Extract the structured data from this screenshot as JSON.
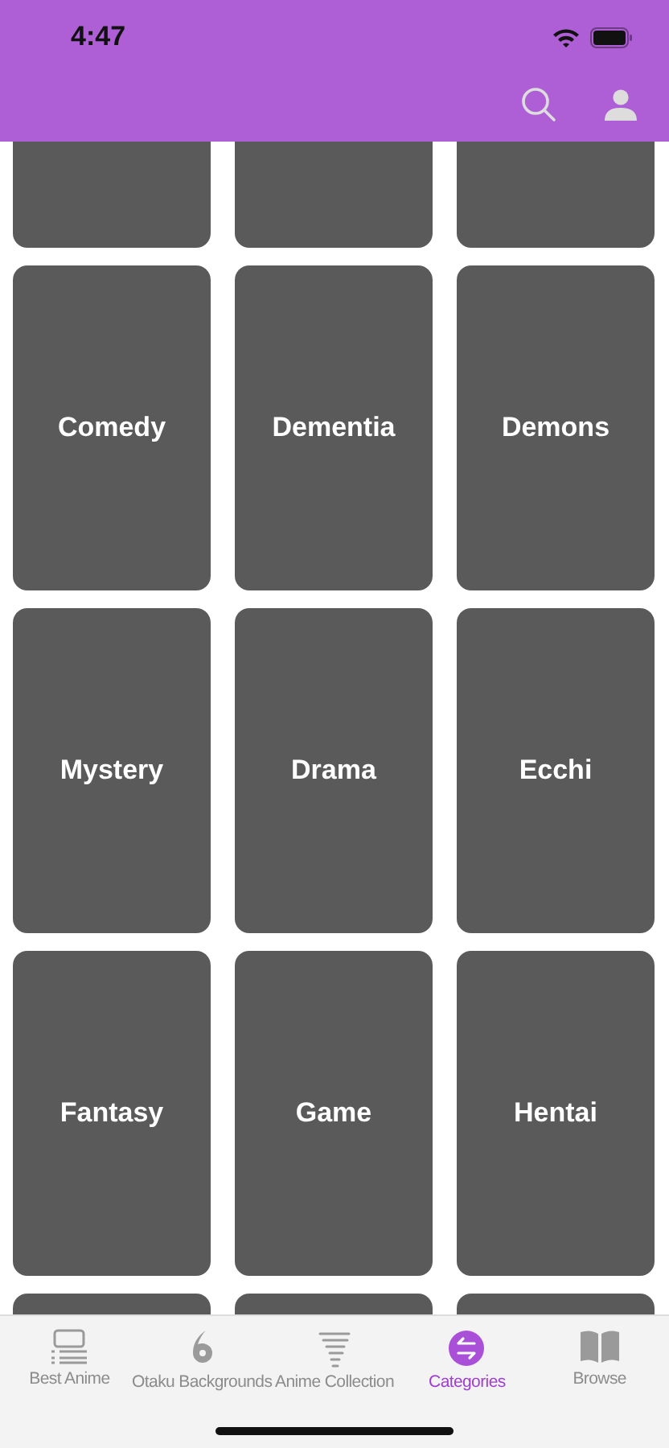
{
  "status_bar": {
    "time": "4:47"
  },
  "categories": [
    {
      "label": "Comedy"
    },
    {
      "label": "Dementia"
    },
    {
      "label": "Demons"
    },
    {
      "label": "Mystery"
    },
    {
      "label": "Drama"
    },
    {
      "label": "Ecchi"
    },
    {
      "label": "Fantasy"
    },
    {
      "label": "Game"
    },
    {
      "label": "Hentai"
    }
  ],
  "tab_bar": [
    {
      "label": "Best Anime",
      "selected": false
    },
    {
      "label": "Otaku Backgrounds",
      "selected": false
    },
    {
      "label": "Anime Collection",
      "selected": false
    },
    {
      "label": "Categories",
      "selected": true
    },
    {
      "label": "Browse",
      "selected": false
    }
  ]
}
